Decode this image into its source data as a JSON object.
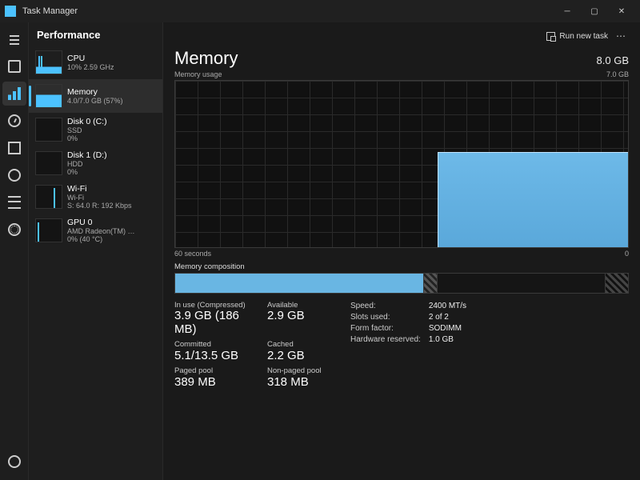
{
  "window": {
    "title": "Task Manager",
    "run_task": "Run new task"
  },
  "tab": {
    "current": "Performance"
  },
  "sidebar": {
    "items": [
      {
        "name": "CPU",
        "sub": "10% 2.59 GHz"
      },
      {
        "name": "Memory",
        "sub": "4.0/7.0 GB (57%)"
      },
      {
        "name": "Disk 0 (C:)",
        "sub": "SSD",
        "sub2": "0%"
      },
      {
        "name": "Disk 1 (D:)",
        "sub": "HDD",
        "sub2": "0%"
      },
      {
        "name": "Wi-Fi",
        "sub": "Wi-Fi",
        "sub2": "S: 64.0 R: 192 Kbps"
      },
      {
        "name": "GPU 0",
        "sub": "AMD Radeon(TM) …",
        "sub2": "0% (40 °C)"
      }
    ]
  },
  "memory": {
    "title": "Memory",
    "usage_label": "Memory usage",
    "total": "8.0 GB",
    "installed": "7.0 GB",
    "x_left": "60 seconds",
    "x_right": "0",
    "comp_label": "Memory composition",
    "stats": {
      "in_use_lbl": "In use (Compressed)",
      "in_use": "3.9 GB (186 MB)",
      "available_lbl": "Available",
      "available": "2.9 GB",
      "committed_lbl": "Committed",
      "committed": "5.1/13.5 GB",
      "cached_lbl": "Cached",
      "cached": "2.2 GB",
      "paged_lbl": "Paged pool",
      "paged": "389 MB",
      "nonpaged_lbl": "Non-paged pool",
      "nonpaged": "318 MB"
    },
    "hw": {
      "speed_k": "Speed:",
      "speed_v": "2400 MT/s",
      "slots_k": "Slots used:",
      "slots_v": "2 of 2",
      "form_k": "Form factor:",
      "form_v": "SODIMM",
      "res_k": "Hardware reserved:",
      "res_v": "1.0 GB"
    }
  },
  "chart_data": {
    "type": "area",
    "title": "Memory usage",
    "ylabel": "GB",
    "ylim": [
      0,
      7.0
    ],
    "xlabel": "seconds ago",
    "xlim": [
      60,
      0
    ],
    "series": [
      {
        "name": "In use",
        "x": [
          60,
          55,
          50,
          45,
          40,
          35,
          30,
          25,
          20,
          15,
          10,
          5,
          0
        ],
        "values": [
          null,
          null,
          null,
          null,
          null,
          null,
          null,
          4.0,
          4.0,
          4.0,
          4.0,
          4.0,
          4.0
        ]
      }
    ]
  }
}
